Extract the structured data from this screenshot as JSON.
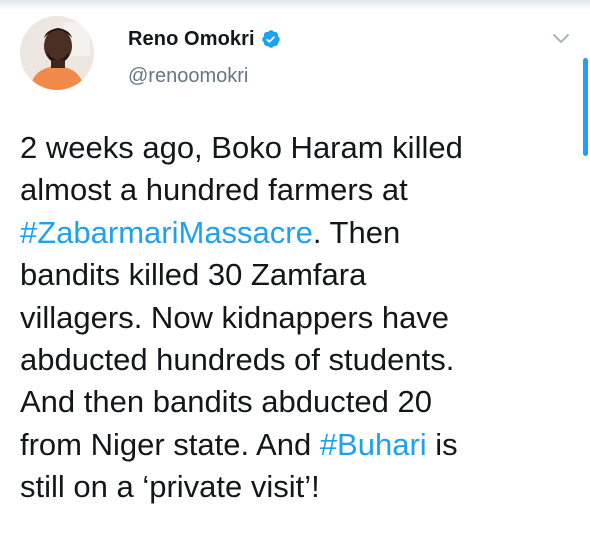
{
  "author": {
    "display_name": "Reno Omokri",
    "handle": "@renoomokri",
    "verified": true
  },
  "icons": {
    "verified": "verified-badge-icon",
    "menu": "chevron-down-icon"
  },
  "colors": {
    "accent": "#1da1f2",
    "text": "#14171a",
    "secondary": "#657786"
  },
  "tweet": {
    "lines": [
      {
        "pre": "2 weeks ago, Boko Haram killed",
        "tag": "",
        "post": ""
      },
      {
        "pre": "almost a hundred farmers at",
        "tag": "",
        "post": ""
      },
      {
        "pre": "",
        "tag": "#ZabarmariMassacre",
        "post": ". Then"
      },
      {
        "pre": "bandits killed 30 Zamfara",
        "tag": "",
        "post": ""
      },
      {
        "pre": "villagers. Now kidnappers have",
        "tag": "",
        "post": ""
      },
      {
        "pre": "abducted hundreds of students.",
        "tag": "",
        "post": ""
      },
      {
        "pre": "And then bandits abducted 20",
        "tag": "",
        "post": ""
      },
      {
        "pre": "from Niger state. And ",
        "tag": "#Buhari",
        "post": " is"
      },
      {
        "pre": "still on a ‘private visit’!",
        "tag": "",
        "post": ""
      }
    ]
  }
}
